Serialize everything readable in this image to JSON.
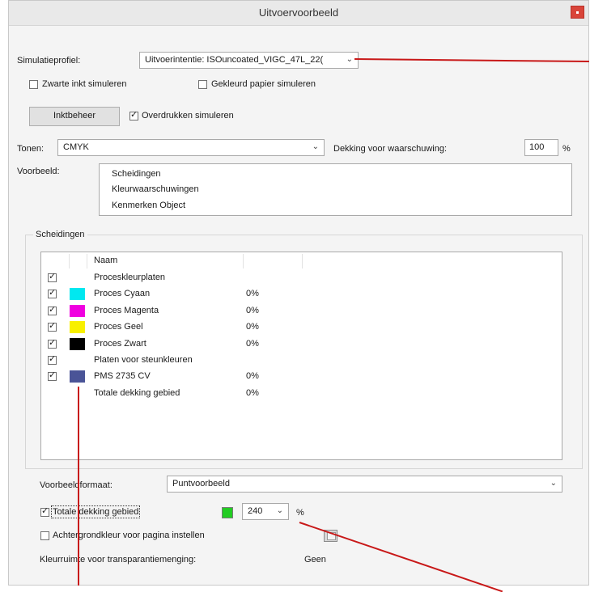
{
  "window": {
    "title": "Uitvoervoorbeeld"
  },
  "simulation": {
    "label": "Simulatieprofiel:",
    "value": "Uitvoerintentie: ISOuncoated_VIGC_47L_22("
  },
  "options": {
    "black_ink": "Zwarte inkt simuleren",
    "paper_color": "Gekleurd papier simuleren",
    "ink_manager": "Inktbeheer",
    "overprint": "Overdrukken simuleren"
  },
  "tones": {
    "label": "Tonen:",
    "value": "CMYK",
    "coverage_label": "Dekking voor waarschuwing:",
    "coverage_value": "100",
    "unit": "%"
  },
  "preview": {
    "label": "Voorbeeld:",
    "items": [
      "Scheidingen",
      "Kleurwaarschuwingen",
      "Kenmerken Object"
    ]
  },
  "separations": {
    "group_label": "Scheidingen",
    "column_name": "Naam",
    "rows": [
      {
        "name": "Proceskleurplaten",
        "pct": "",
        "checked": true,
        "color": ""
      },
      {
        "name": "Proces Cyaan",
        "pct": "0%",
        "checked": true,
        "color": "#00e8f0"
      },
      {
        "name": "Proces Magenta",
        "pct": "0%",
        "checked": true,
        "color": "#f000e0"
      },
      {
        "name": "Proces Geel",
        "pct": "0%",
        "checked": true,
        "color": "#f8f000"
      },
      {
        "name": "Proces Zwart",
        "pct": "0%",
        "checked": true,
        "color": "#000000"
      },
      {
        "name": "Platen voor steunkleuren",
        "pct": "",
        "checked": true,
        "color": ""
      },
      {
        "name": "PMS 2735 CV",
        "pct": "0%",
        "checked": true,
        "color": "#4a5497"
      },
      {
        "name": "Totale dekking gebied",
        "pct": "0%",
        "checked": false,
        "color": ""
      }
    ]
  },
  "preview_format": {
    "label": "Voorbeeldformaat:",
    "value": "Puntvoorbeeld"
  },
  "total_coverage": {
    "label": "Totale dekking gebied",
    "value": "240",
    "unit": "%",
    "swatch_color": "#22cc22"
  },
  "background": {
    "label": "Achtergrondkleur voor pagina instellen"
  },
  "color_space": {
    "label": "Kleurruimte voor transparantiemenging:",
    "value": "Geen"
  }
}
